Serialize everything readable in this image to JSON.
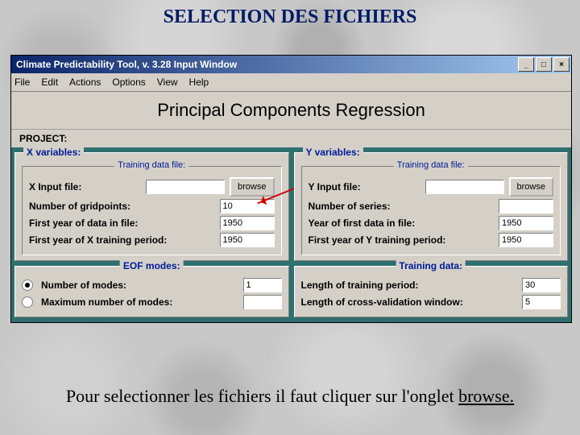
{
  "slide": {
    "title": "SELECTION DES FICHIERS",
    "caption_prefix": "Pour selectionner les fichiers il faut cliquer sur l'onglet ",
    "caption_link": "browse."
  },
  "window": {
    "titlebar": "Climate Predictability Tool, v. 3.28   Input Window",
    "btn_min": "_",
    "btn_max": "□",
    "btn_close": "×",
    "menu": {
      "file": "File",
      "edit": "Edit",
      "actions": "Actions",
      "options": "Options",
      "view": "View",
      "help": "Help"
    },
    "app_title": "Principal Components Regression",
    "project_label": "PROJECT:"
  },
  "x": {
    "legend": "X variables:",
    "training_legend": "Training data file:",
    "input_label": "X Input file:",
    "browse": "browse",
    "gridpoints_label": "Number of gridpoints:",
    "gridpoints_val": "10",
    "firstyear_label": "First year of data in file:",
    "firstyear_val": "1950",
    "trainyear_label": "First year of X training period:",
    "trainyear_val": "1950"
  },
  "y": {
    "legend": "Y variables:",
    "training_legend": "Training data file:",
    "input_label": "Y Input file:",
    "browse": "browse",
    "series_label": "Number of series:",
    "series_val": "",
    "firstyear_label": "Year of first data in file:",
    "firstyear_val": "1950",
    "trainyear_label": "First year of Y training period:",
    "trainyear_val": "1950"
  },
  "eof": {
    "legend": "EOF modes:",
    "num_label": "Number of modes:",
    "num_val": "1",
    "max_label": "Maximum number of modes:",
    "max_val": ""
  },
  "train": {
    "legend": "Training data:",
    "len_label": "Length of training period:",
    "len_val": "30",
    "cv_label": "Length of cross-validation window:",
    "cv_val": "5"
  }
}
